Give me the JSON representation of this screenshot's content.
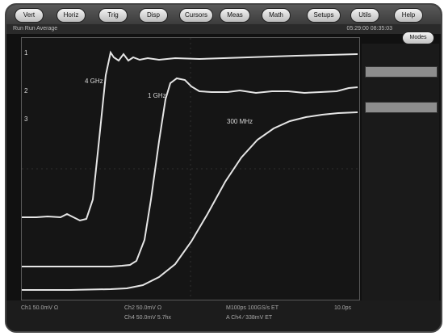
{
  "menu": [
    "Vert",
    "Horiz",
    "Trig",
    "Disp",
    "Cursors",
    "Meas",
    "Math",
    "Setups",
    "Utils",
    "Help"
  ],
  "status": {
    "left": "Run  Run  Average",
    "right": "05:29:00 08:35:03"
  },
  "modes_button": "Modes",
  "markers": {
    "m1": "1",
    "m2": "2",
    "m3": "3"
  },
  "annotations": {
    "trace1": "4 GHz",
    "trace2": "1 GHz",
    "trace3": "300 MHz"
  },
  "bottom": {
    "ch1": "Ch1  50.0mV Ω",
    "ch2": "Ch2  50.0mV Ω",
    "ch4": "Ch4  50.0mV 5.7hx",
    "timebase": "M100ps 100GS/s  ET",
    "trigger": "A  Ch4  ⁄  338mV  ET",
    "record": "10.0ps"
  },
  "colors": {
    "trace": "#e5e5e5",
    "screen": "#151515"
  }
}
